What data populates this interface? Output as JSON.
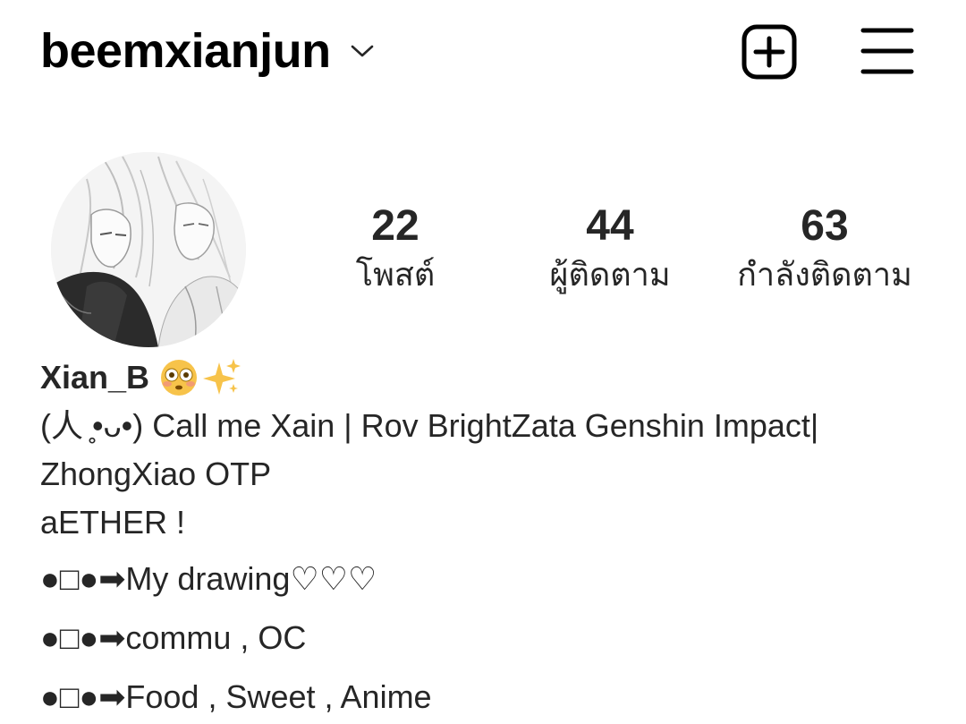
{
  "header": {
    "username": "beemxianjun",
    "chevron_icon": "chevron-down-icon",
    "new_post_icon": "plus-square-icon",
    "menu_icon": "hamburger-menu-icon"
  },
  "profile": {
    "avatar_alt": "profile avatar",
    "stats": [
      {
        "value": "22",
        "label": "โพสต์"
      },
      {
        "value": "44",
        "label": "ผู้ติดตาม"
      },
      {
        "value": "63",
        "label": "กำลังติดตาม"
      }
    ]
  },
  "bio": {
    "display_name": "Xian_B",
    "name_emojis": [
      "flushed-face-icon",
      "sparkles-icon"
    ],
    "lines": [
      "(人 ̥•ᴗ•) Call me Xain | Rov BrightZata Genshin Impact|",
      "ZhongXiao OTP",
      "aETHER !",
      "●□●➡My drawing♡♡♡",
      "●□●➡commu , OC",
      "●□●➡Food , Sweet , Anime"
    ]
  },
  "colors": {
    "text": "#262626",
    "background": "#ffffff",
    "icon": "#000000"
  }
}
